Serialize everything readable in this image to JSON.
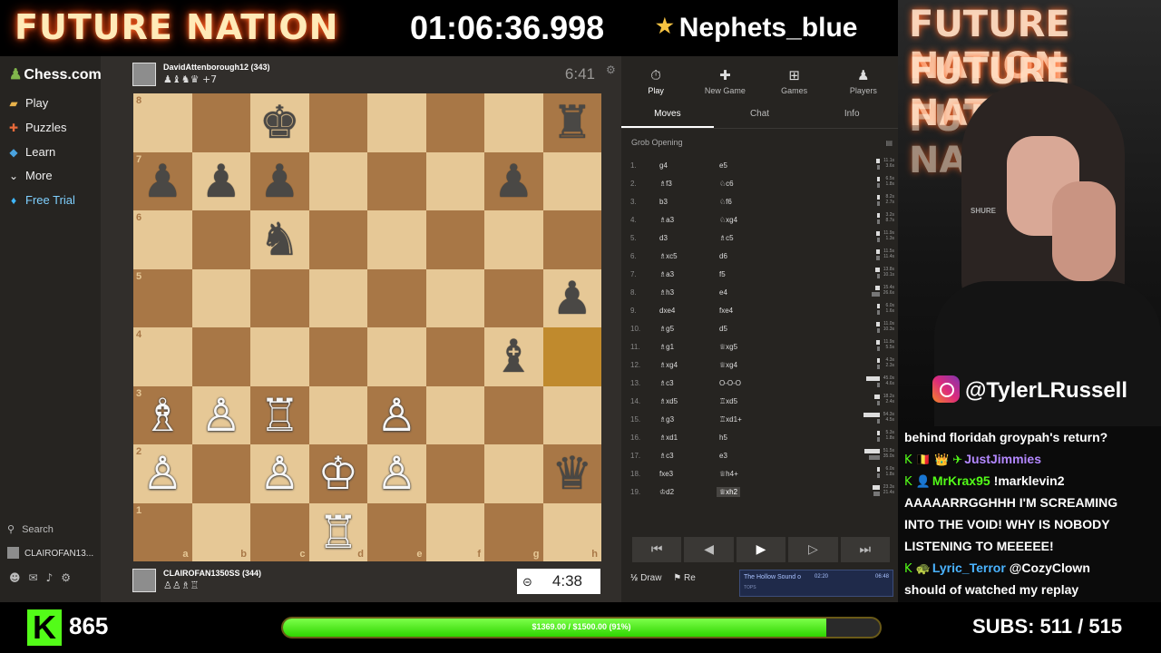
{
  "stream": {
    "brand": "FUTURE NATION",
    "timer": "01:06:36.998",
    "featured_user": "Nephets_blue",
    "instagram": "@TylerLRussell"
  },
  "sidebar": {
    "logo": "Chess.com",
    "items": [
      {
        "label": "Play",
        "icon": "play-icon"
      },
      {
        "label": "Puzzles",
        "icon": "puzzle-icon"
      },
      {
        "label": "Learn",
        "icon": "learn-icon"
      },
      {
        "label": "More",
        "icon": "chevron-down-icon"
      },
      {
        "label": "Free Trial",
        "icon": "diamond-icon"
      }
    ],
    "search": "Search",
    "username": "CLAIROFAN13..."
  },
  "game": {
    "top_player": {
      "name": "DavidAttenborough12 (343)",
      "captured": "♟♝♞♛ +7",
      "clock": "6:41"
    },
    "bottom_player": {
      "name": "CLAIROFAN1350SS (344)",
      "captured": "♙♙♗♖",
      "clock": "4:38"
    }
  },
  "board": {
    "ranks": [
      "8",
      "7",
      "6",
      "5",
      "4",
      "3",
      "2",
      "1"
    ],
    "files": [
      "a",
      "b",
      "c",
      "d",
      "e",
      "f",
      "g",
      "h"
    ],
    "squares": [
      [
        null,
        null,
        "bk",
        null,
        null,
        null,
        null,
        "br"
      ],
      [
        "bp",
        "bp",
        "bp",
        null,
        null,
        null,
        "bp",
        null
      ],
      [
        null,
        null,
        "bn",
        null,
        null,
        null,
        null,
        null
      ],
      [
        null,
        null,
        null,
        null,
        null,
        null,
        null,
        "bp"
      ],
      [
        null,
        null,
        null,
        null,
        null,
        null,
        "bb",
        null
      ],
      [
        "wb",
        "wp",
        "wr",
        null,
        "wp",
        null,
        null,
        null
      ],
      [
        "wp",
        null,
        "wp",
        "wk",
        "wp",
        null,
        null,
        "bq"
      ],
      [
        null,
        null,
        null,
        "wr",
        null,
        null,
        null,
        null
      ]
    ],
    "highlight": [
      "h4"
    ]
  },
  "panel": {
    "tabs": [
      {
        "label": "Play",
        "icon": "clock-icon"
      },
      {
        "label": "New Game",
        "icon": "plus-icon"
      },
      {
        "label": "Games",
        "icon": "games-icon"
      },
      {
        "label": "Players",
        "icon": "players-icon"
      }
    ],
    "subtabs": [
      "Moves",
      "Chat",
      "Info"
    ],
    "opening": "Grob Opening",
    "moves": [
      {
        "n": "1.",
        "w": "g4",
        "b": "e5",
        "t1": "11.1s",
        "t2": "3.6s"
      },
      {
        "n": "2.",
        "w": "♗f3",
        "b": "♘c6",
        "t1": "6.5s",
        "t2": "1.8s"
      },
      {
        "n": "3.",
        "w": "b3",
        "b": "♘f6",
        "t1": "8.2s",
        "t2": "2.7s"
      },
      {
        "n": "4.",
        "w": "♗a3",
        "b": "♘xg4",
        "t1": "3.2s",
        "t2": "8.7s"
      },
      {
        "n": "5.",
        "w": "d3",
        "b": "♗c5",
        "t1": "11.9s",
        "t2": "1.3s"
      },
      {
        "n": "6.",
        "w": "♗xc5",
        "b": "d6",
        "t1": "11.5s",
        "t2": "11.4s"
      },
      {
        "n": "7.",
        "w": "♗a3",
        "b": "f5",
        "t1": "13.8s",
        "t2": "10.1s"
      },
      {
        "n": "8.",
        "w": "♗h3",
        "b": "e4",
        "t1": "15.4s",
        "t2": "26.6s"
      },
      {
        "n": "9.",
        "w": "dxe4",
        "b": "fxe4",
        "t1": "6.0s",
        "t2": "1.6s"
      },
      {
        "n": "10.",
        "w": "♗g5",
        "b": "d5",
        "t1": "11.0s",
        "t2": "10.3s"
      },
      {
        "n": "11.",
        "w": "♗g1",
        "b": "♕xg5",
        "t1": "11.9s",
        "t2": "5.5s"
      },
      {
        "n": "12.",
        "w": "♗xg4",
        "b": "♕xg4",
        "t1": "4.3s",
        "t2": "2.3s"
      },
      {
        "n": "13.",
        "w": "♗c3",
        "b": "O-O-O",
        "t1": "45.0s",
        "t2": "4.6s"
      },
      {
        "n": "14.",
        "w": "♗xd5",
        "b": "♖xd5",
        "t1": "18.2s",
        "t2": "2.4s"
      },
      {
        "n": "15.",
        "w": "♗g3",
        "b": "♖xd1+",
        "t1": "54.3s",
        "t2": "4.5s"
      },
      {
        "n": "16.",
        "w": "♗xd1",
        "b": "h5",
        "t1": "5.3s",
        "t2": "1.8s"
      },
      {
        "n": "17.",
        "w": "♗c3",
        "b": "e3",
        "t1": "51.5s",
        "t2": "35.0s"
      },
      {
        "n": "18.",
        "w": "fxe3",
        "b": "♕h4+",
        "t1": "6.0s",
        "t2": "1.8s"
      },
      {
        "n": "19.",
        "w": "♔d2",
        "b": "♕xh2",
        "t1": "23.3s",
        "t2": "21.4s"
      }
    ],
    "actions": {
      "draw": "Draw",
      "resign": "Re"
    },
    "music": {
      "title": "The Hollow Sound o",
      "sub": "TOPS",
      "elapsed": "02:20",
      "total": "06:48"
    }
  },
  "chat": [
    {
      "user": "",
      "text": "behind floridah groypah's return?",
      "color": "#ffffff"
    },
    {
      "user": "JustJimmies",
      "text": "",
      "color": "#b388ff",
      "badges": "K 🇧🇪 👑 ✈ "
    },
    {
      "user": "MrKrax95",
      "text": "!marklevin2",
      "color": "#53fc18",
      "badges": "K 👤 "
    },
    {
      "user": "",
      "text": "AAAAARRGGHHH I'M SCREAMING",
      "color": "#ffffff"
    },
    {
      "user": "",
      "text": "INTO THE VOID! WHY IS NOBODY",
      "color": "#ffffff"
    },
    {
      "user": "",
      "text": "LISTENING TO MEEEEE!",
      "color": "#ffffff"
    },
    {
      "user": "Lyric_Terror",
      "text": "@CozyClown",
      "color": "#4ab3ff",
      "badges": "K 🐢 "
    },
    {
      "user": "",
      "text": "should of watched my replay",
      "color": "#ffffff"
    }
  ],
  "footer": {
    "kick_logo": "K",
    "followers": "865",
    "goal_label": "$1369.00 / $1500.00 (91%)",
    "goal_fraction": 0.91,
    "subs": "SUBS:  511 / 515"
  },
  "colors": {
    "kick_green": "#53fc18",
    "board_light": "#e6c896",
    "board_dark": "#a87746",
    "panel_bg": "#262421"
  }
}
